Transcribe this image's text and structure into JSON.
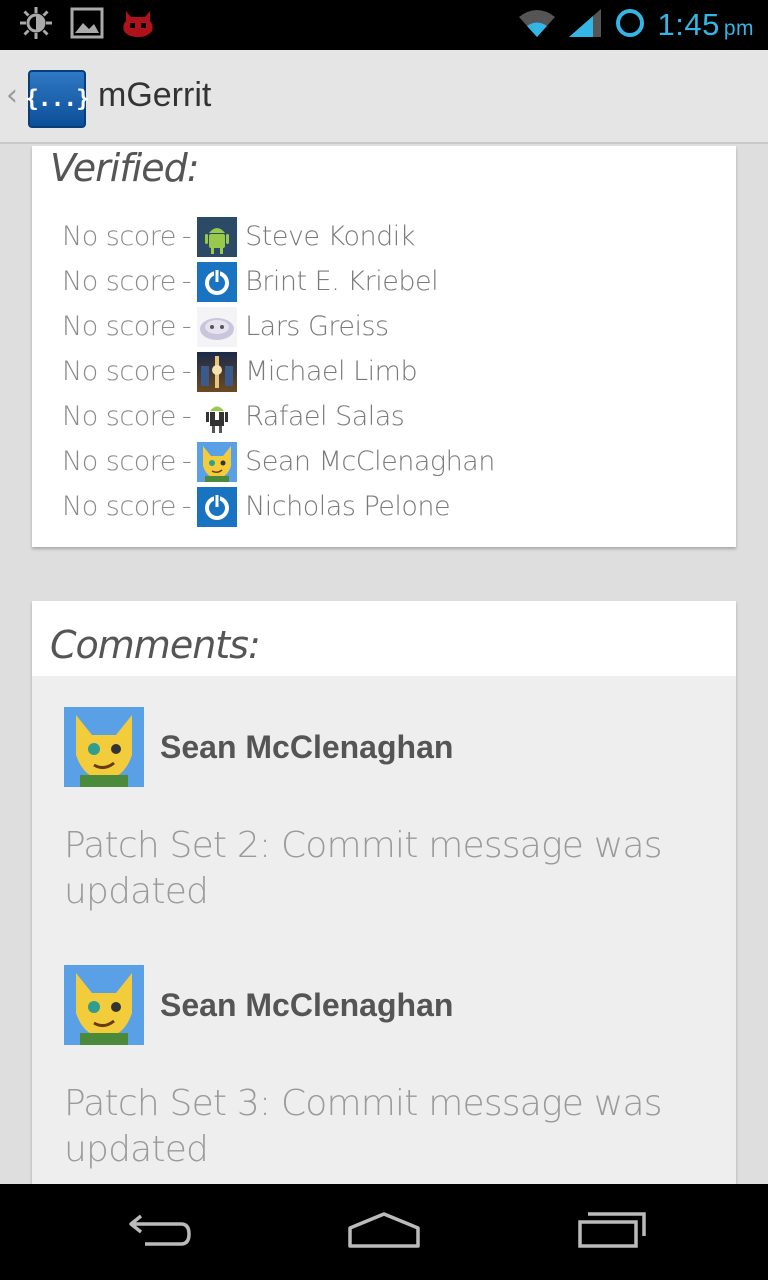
{
  "status_bar": {
    "time": "1:45",
    "ampm": "pm",
    "icons": [
      "brightness-icon",
      "gallery-icon",
      "cyanogen-mod-icon",
      "wifi-icon",
      "signal-icon",
      "sync-icon"
    ]
  },
  "action_bar": {
    "app_icon_text": "{...}",
    "title": "mGerrit"
  },
  "verified": {
    "title": "Verified:",
    "reviewers": [
      {
        "score": "No score",
        "sep": "-",
        "name": "Steve Kondik",
        "avatar": "android-robot-avatar"
      },
      {
        "score": "No score",
        "sep": "-",
        "name": "Brint E. Kriebel",
        "avatar": "power-logo-avatar"
      },
      {
        "score": "No score",
        "sep": "-",
        "name": "Lars Greiss",
        "avatar": "creature-avatar"
      },
      {
        "score": "No score",
        "sep": "-",
        "name": "Michael Limb",
        "avatar": "scifi-photo-avatar"
      },
      {
        "score": "No score",
        "sep": "-",
        "name": "Rafael Salas",
        "avatar": "android-suit-avatar"
      },
      {
        "score": "No score",
        "sep": "-",
        "name": "Sean McClenaghan",
        "avatar": "fox-cartoon-avatar"
      },
      {
        "score": "No score",
        "sep": "-",
        "name": "Nicholas Pelone",
        "avatar": "power-logo-avatar"
      }
    ]
  },
  "comments": {
    "title": "Comments:",
    "items": [
      {
        "author": "Sean McClenaghan",
        "text": "Patch Set 2: Commit message was updated"
      },
      {
        "author": "Sean McClenaghan",
        "text": "Patch Set 3: Commit message was updated"
      }
    ]
  },
  "nav_bar": {
    "buttons": [
      "back-icon",
      "home-icon",
      "recent-apps-icon"
    ]
  },
  "colors": {
    "accent": "#33b5e5",
    "app_icon_blue": "#1f65b0"
  }
}
